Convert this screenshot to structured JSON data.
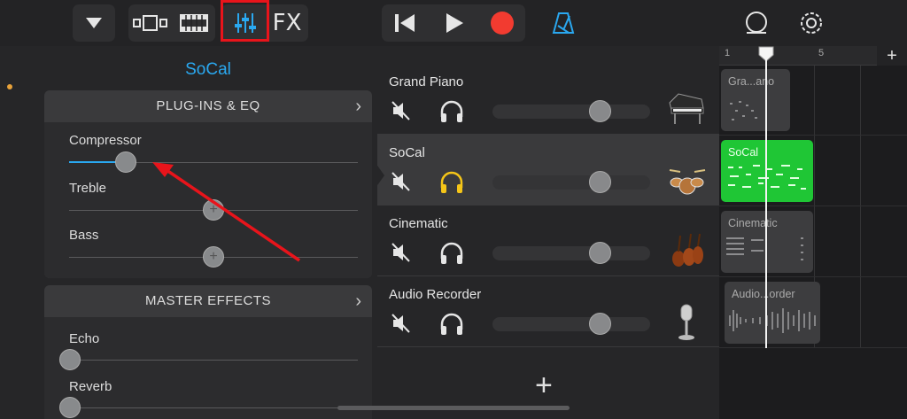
{
  "toolbar": {
    "fx_label": "FX",
    "icons": [
      "browser-dropdown-icon",
      "tracks-view-icon",
      "smart-controls-icon",
      "mixer-icon",
      "go-to-start-icon",
      "play-icon",
      "record-icon",
      "metronome-icon",
      "loop-icon",
      "settings-icon"
    ],
    "record_color": "#f23b30",
    "accent_color": "#2aa8f0"
  },
  "left_panel": {
    "title": "SoCal",
    "plugins": {
      "header": "PLUG-INS & EQ",
      "chevron": "›",
      "controls": [
        {
          "label": "Compressor",
          "value": 0.2
        },
        {
          "label": "Treble",
          "value": 0.5
        },
        {
          "label": "Bass",
          "value": 0.5
        }
      ]
    },
    "master": {
      "header": "MASTER EFFECTS",
      "chevron": "›",
      "controls": [
        {
          "label": "Echo",
          "value": 0.0
        },
        {
          "label": "Reverb",
          "value": 0.0
        }
      ]
    }
  },
  "tracks": {
    "items": [
      {
        "name": "Grand Piano",
        "instrument": "grand-piano-icon",
        "muted": true,
        "headphone_active": false,
        "volume": 0.67
      },
      {
        "name": "SoCal",
        "instrument": "drum-kit-icon",
        "muted": true,
        "headphone_active": true,
        "volume": 0.67,
        "selected": true
      },
      {
        "name": "Cinematic",
        "instrument": "strings-icon",
        "muted": true,
        "headphone_active": false,
        "volume": 0.67
      },
      {
        "name": "Audio Recorder",
        "instrument": "microphone-icon",
        "muted": true,
        "headphone_active": false,
        "volume": 0.67
      }
    ],
    "add_label": "+"
  },
  "timeline": {
    "ruler_marks": [
      "1",
      "5"
    ],
    "add_label": "+",
    "regions": [
      {
        "label": "Gra...ano",
        "color": "#3d3d3f"
      },
      {
        "label": "SoCal",
        "color": "#1fc635"
      },
      {
        "label": "Cinematic",
        "color": "#3d3d3f"
      },
      {
        "label": "Audio...order",
        "color": "#3d3d3f"
      }
    ]
  }
}
